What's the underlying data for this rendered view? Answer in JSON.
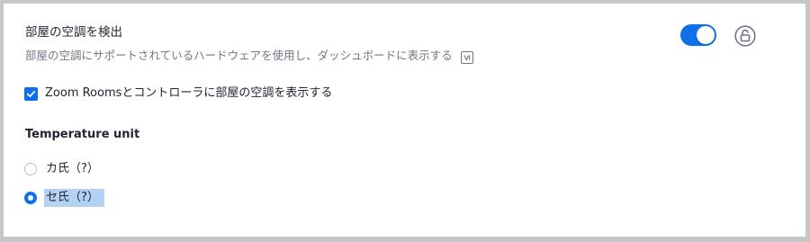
{
  "setting": {
    "title": "部屋の空調を検出",
    "description": "部屋の空調にサポートされているハードウェアを使用し、ダッシュボードに表示する",
    "description_icon": "v-icon",
    "toggle_on": true,
    "lock_icon": "unlock-icon"
  },
  "checkbox": {
    "label": "Zoom Roomsとコントローラに部屋の空調を表示する",
    "checked": true
  },
  "temperature": {
    "label": "Temperature unit",
    "options": [
      {
        "label": "カ氏（?）",
        "selected": false
      },
      {
        "label": "セ氏（?）",
        "selected": true
      }
    ]
  },
  "colors": {
    "accent": "#0e71eb",
    "selection_highlight": "#b3d2f3",
    "background": "#c6c6c6"
  }
}
